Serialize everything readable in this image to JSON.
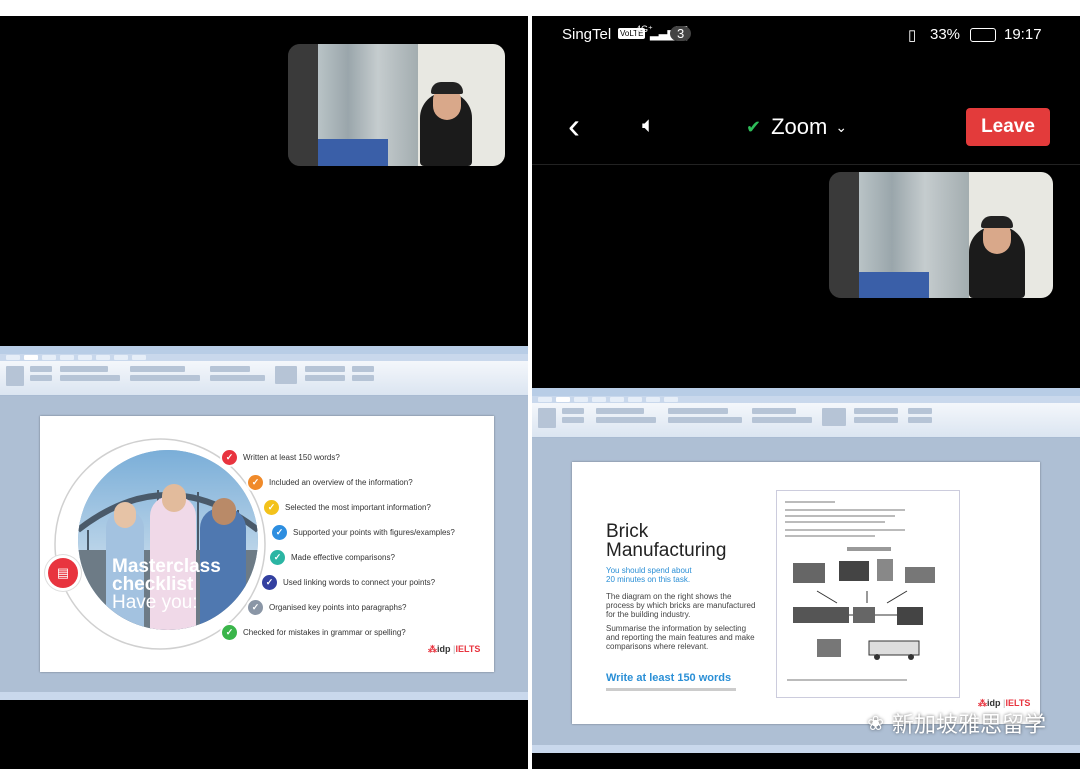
{
  "masterclass": {
    "title_line1": "Masterclass",
    "title_line2": "checklist",
    "title_line3": "Have you:",
    "items": [
      {
        "label": "Written at least 150 words?",
        "color": "#e8343f"
      },
      {
        "label": "Included an overview of the information?",
        "color": "#f08a2a"
      },
      {
        "label": "Selected the most important information?",
        "color": "#f3c21b"
      },
      {
        "label": "Supported your points with figures/examples?",
        "color": "#2d8ee0"
      },
      {
        "label": "Made effective comparisons?",
        "color": "#2bb5a3"
      },
      {
        "label": "Used linking words to connect your points?",
        "color": "#3340a0"
      },
      {
        "label": "Organised key points into paragraphs?",
        "color": "#8a96a6"
      },
      {
        "label": "Checked for mistakes in grammar or spelling?",
        "color": "#3ab54a"
      }
    ],
    "logo_idp": "idp",
    "logo_ielts": "IELTS"
  },
  "phone": {
    "carrier": "SingTel",
    "volte": "VoLTE",
    "network": "4G⁺",
    "notifications": "3",
    "battery": "33%",
    "time": "19:17"
  },
  "zoom": {
    "meeting_label": "Zoom",
    "leave_label": "Leave"
  },
  "brick": {
    "title_line1": "Brick",
    "title_line2": "Manufacturing",
    "spend_line1": "You should spend about",
    "spend_line2": "20 minutes on this task.",
    "diagram_text": "The diagram on the right shows the process by which bricks are manufactured for the building industry.",
    "summarise_text": "Summarise the information by selecting and reporting the main features and make comparisons where relevant.",
    "write_text": "Write at least 150 words",
    "logo_idp": "idp",
    "logo_ielts": "IELTS"
  },
  "watermark": {
    "text": "新加坡雅思留学"
  }
}
